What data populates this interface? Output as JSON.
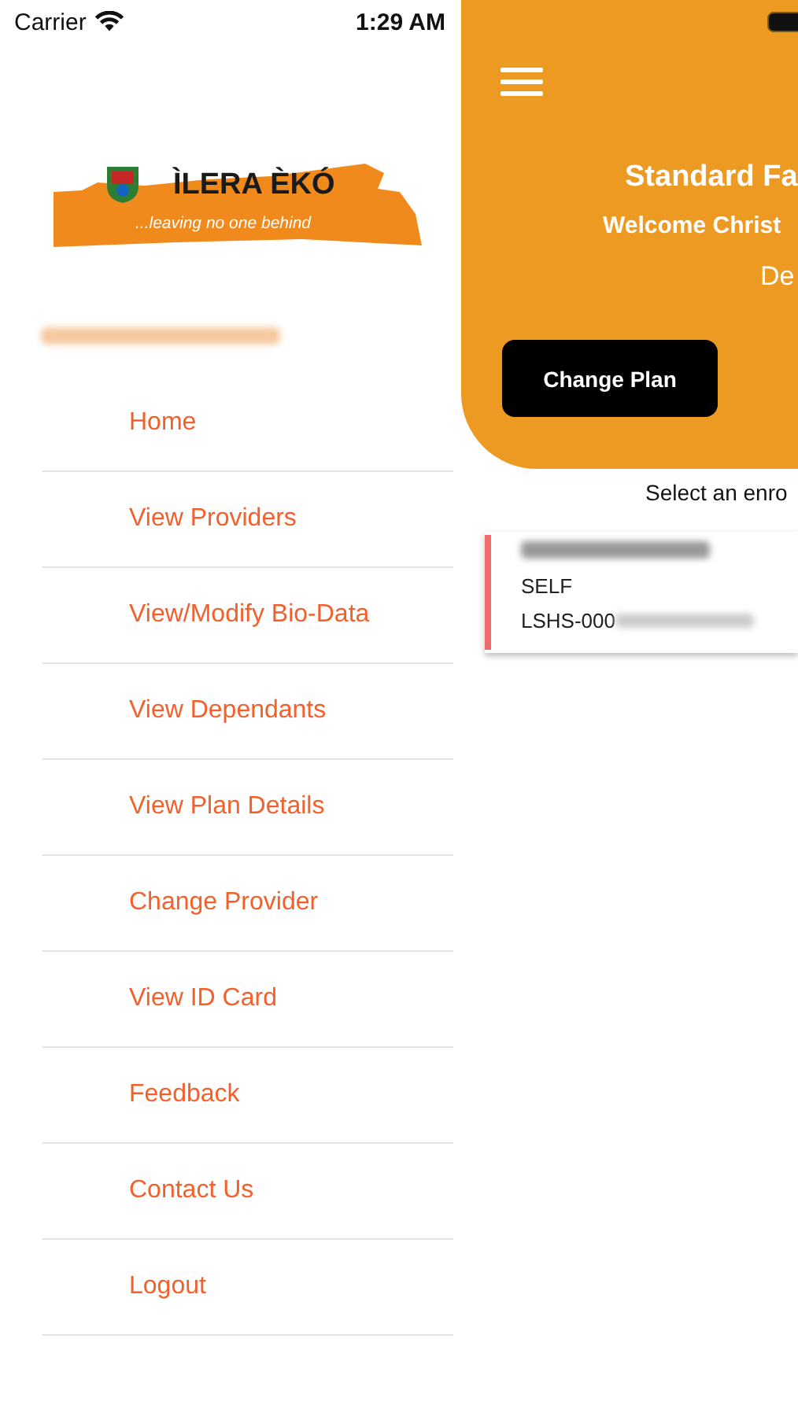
{
  "status_bar": {
    "carrier": "Carrier",
    "time": "1:29 AM"
  },
  "logo": {
    "name": "ÌLERA ÈKÓ",
    "tagline": "...leaving no one behind"
  },
  "menu": [
    {
      "label": "Home"
    },
    {
      "label": "View Providers"
    },
    {
      "label": "View/Modify Bio-Data"
    },
    {
      "label": "View Dependants"
    },
    {
      "label": "View Plan Details"
    },
    {
      "label": "Change Provider"
    },
    {
      "label": "View ID Card"
    },
    {
      "label": "Feedback"
    },
    {
      "label": "Contact Us"
    },
    {
      "label": "Logout"
    }
  ],
  "header": {
    "title": "Standard Fa",
    "welcome": "Welcome Christ",
    "subtitle": "De",
    "button": "Change Plan"
  },
  "prompt": "Select an enro",
  "enrollees": [
    {
      "relation": "SELF",
      "id_prefix": "LSHS-000",
      "color": "#f26a6a"
    }
  ]
}
